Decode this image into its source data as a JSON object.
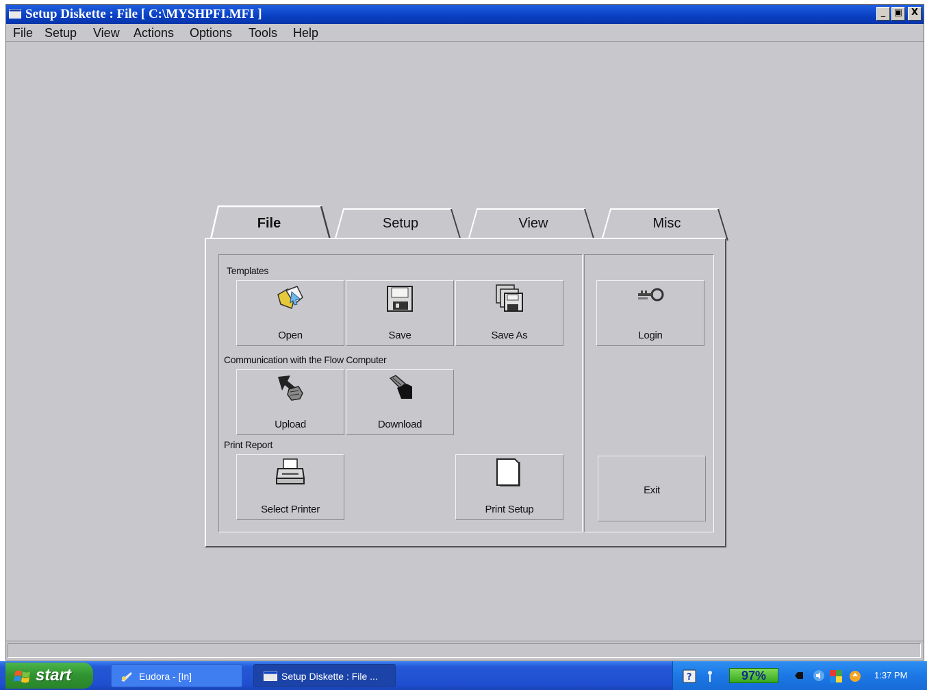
{
  "window": {
    "title": "Setup Diskette : File [ C:\\MYSHPFI.MFI ]",
    "controls": {
      "minimize": "_",
      "maximize": "▣",
      "close": "X"
    }
  },
  "menubar": [
    "File",
    "Setup",
    "View",
    "Actions",
    "Options",
    "Tools",
    "Help"
  ],
  "tabs": [
    {
      "label": "File",
      "active": true
    },
    {
      "label": "Setup",
      "active": false
    },
    {
      "label": "View",
      "active": false
    },
    {
      "label": "Misc",
      "active": false
    }
  ],
  "groups": {
    "templates": {
      "label": "Templates",
      "buttons": [
        {
          "label": "Open",
          "icon": "open-folder-icon"
        },
        {
          "label": "Save",
          "icon": "floppy-disk-icon"
        },
        {
          "label": "Save As",
          "icon": "save-as-icon"
        }
      ]
    },
    "communication": {
      "label": "Communication with the Flow Computer",
      "buttons": [
        {
          "label": "Upload",
          "icon": "upload-hand-icon"
        },
        {
          "label": "Download",
          "icon": "download-hand-icon"
        }
      ]
    },
    "print_report": {
      "label": "Print Report",
      "buttons": [
        {
          "label": "Select Printer",
          "icon": "printer-icon"
        },
        {
          "label": "Print Setup",
          "icon": "page-icon"
        }
      ]
    },
    "side": {
      "buttons": [
        {
          "label": "Login",
          "icon": "key-icon"
        },
        {
          "label": "Exit",
          "icon": ""
        }
      ]
    }
  },
  "taskbar": {
    "start_label": "start",
    "tasks": [
      {
        "label": "Eudora - [In]"
      },
      {
        "label": "Setup Diskette : File ..."
      }
    ],
    "tray": {
      "battery": "97%",
      "clock": "1:37 PM"
    }
  },
  "colors": {
    "window_bg": "#c8c7cc",
    "titlebar": "#0a3fc2",
    "taskbar": "#2458d6",
    "start_button": "#2f932f"
  }
}
